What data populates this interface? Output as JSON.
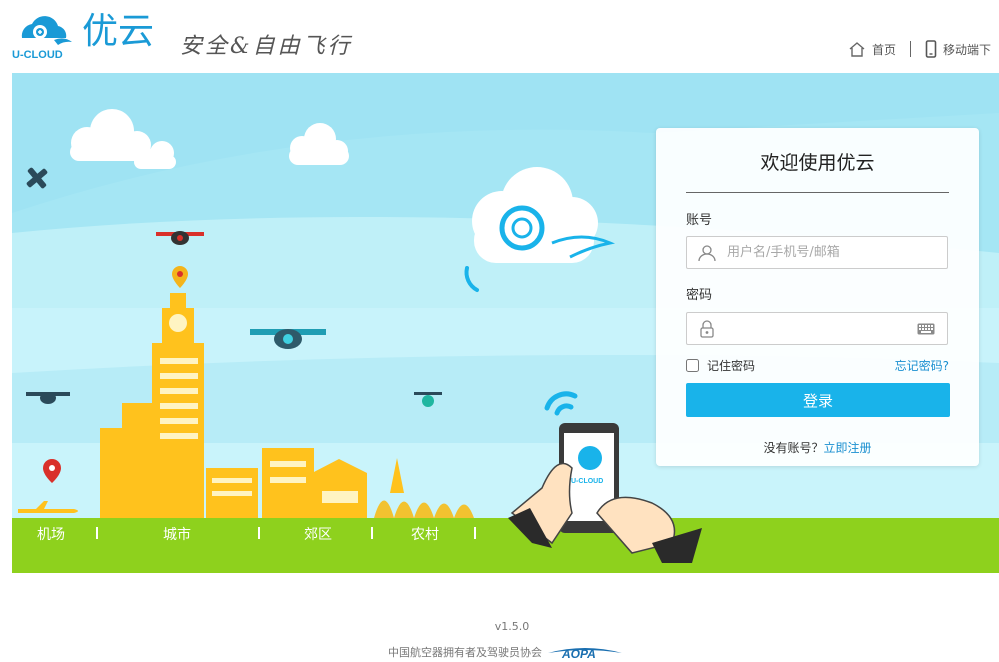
{
  "header": {
    "logo_text": "U-CLOUD",
    "brand": "优云",
    "slogan": "安全&自由飞行",
    "nav": {
      "home": "首页",
      "mobile": "移动端下"
    }
  },
  "banner": {
    "nav": [
      "机场",
      "城市",
      "郊区",
      "农村"
    ],
    "phone_logo": "U-CLOUD"
  },
  "login": {
    "title": "欢迎使用优云",
    "account_label": "账号",
    "account_placeholder": "用户名/手机号/邮箱",
    "account_value": "",
    "password_label": "密码",
    "password_value": "",
    "remember_label": "记住密码",
    "forgot_label": "忘记密码?",
    "submit_label": "登录",
    "no_account": "没有账号？",
    "register_label": "立即注册"
  },
  "footer": {
    "version": "v1.5.0",
    "org": "中国航空器拥有者及驾驶员协会",
    "org_logo": "AOPA"
  },
  "colors": {
    "brand": "#1a9ad6",
    "button": "#19b3ea",
    "grass": "#8ed11d",
    "sky": "#a5e6f4",
    "building": "#ffc21d"
  }
}
